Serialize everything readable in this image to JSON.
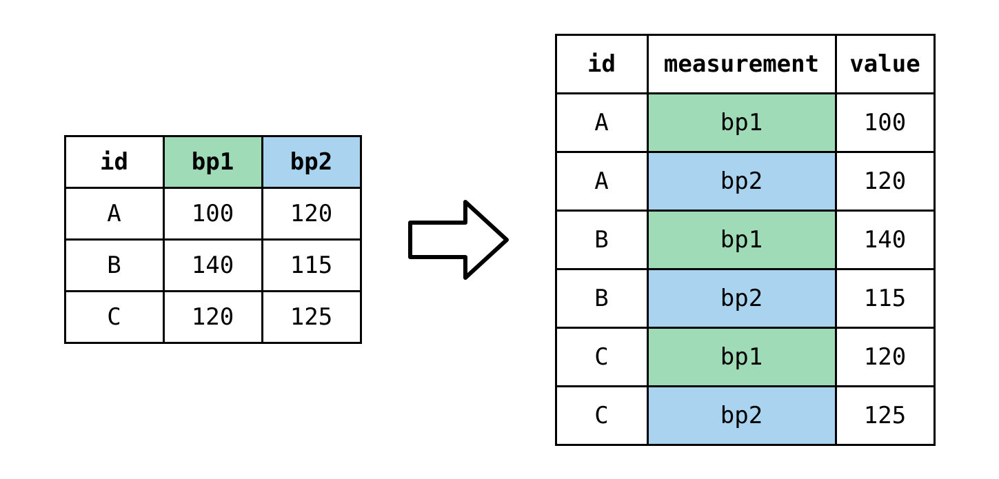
{
  "colors": {
    "green": "#9edbb6",
    "blue": "#a9d3ee"
  },
  "wide_table": {
    "headers": {
      "id": "id",
      "bp1": "bp1",
      "bp2": "bp2"
    },
    "rows": [
      {
        "id": "A",
        "bp1": "100",
        "bp2": "120"
      },
      {
        "id": "B",
        "bp1": "140",
        "bp2": "115"
      },
      {
        "id": "C",
        "bp1": "120",
        "bp2": "125"
      }
    ]
  },
  "long_table": {
    "headers": {
      "id": "id",
      "measurement": "measurement",
      "value": "value"
    },
    "rows": [
      {
        "id": "A",
        "measurement": "bp1",
        "value": "100",
        "color": "green"
      },
      {
        "id": "A",
        "measurement": "bp2",
        "value": "120",
        "color": "blue"
      },
      {
        "id": "B",
        "measurement": "bp1",
        "value": "140",
        "color": "green"
      },
      {
        "id": "B",
        "measurement": "bp2",
        "value": "115",
        "color": "blue"
      },
      {
        "id": "C",
        "measurement": "bp1",
        "value": "120",
        "color": "green"
      },
      {
        "id": "C",
        "measurement": "bp2",
        "value": "125",
        "color": "blue"
      }
    ]
  },
  "chart_data": {
    "type": "table",
    "wide": {
      "columns": [
        "id",
        "bp1",
        "bp2"
      ],
      "rows": [
        {
          "id": "A",
          "bp1": 100,
          "bp2": 120
        },
        {
          "id": "B",
          "bp1": 140,
          "bp2": 115
        },
        {
          "id": "C",
          "bp1": 120,
          "bp2": 125
        }
      ]
    },
    "long": {
      "columns": [
        "id",
        "measurement",
        "value"
      ],
      "rows": [
        {
          "id": "A",
          "measurement": "bp1",
          "value": 100
        },
        {
          "id": "A",
          "measurement": "bp2",
          "value": 120
        },
        {
          "id": "B",
          "measurement": "bp1",
          "value": 140
        },
        {
          "id": "B",
          "measurement": "bp2",
          "value": 115
        },
        {
          "id": "C",
          "measurement": "bp1",
          "value": 120
        },
        {
          "id": "C",
          "measurement": "bp2",
          "value": 125
        }
      ]
    },
    "color_map": {
      "bp1": "green",
      "bp2": "blue"
    }
  }
}
